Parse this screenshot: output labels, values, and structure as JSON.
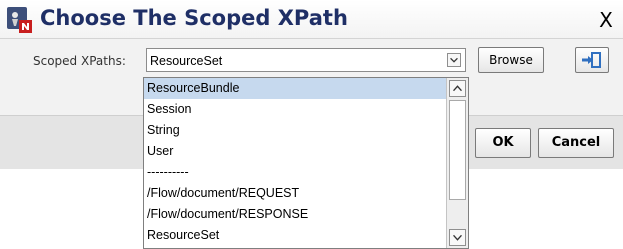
{
  "dialog": {
    "title": "Choose The Scoped XPath",
    "close_label": "X"
  },
  "form": {
    "scoped_xpaths_label": "Scoped XPaths:",
    "selected_value": "ResourceSet",
    "browse_label": "Browse",
    "import_icon": "import-arrow-icon"
  },
  "dropdown": {
    "items": [
      "ResourceBundle",
      "Session",
      "String",
      "User",
      "----------",
      "/Flow/document/REQUEST",
      "/Flow/document/RESPONSE",
      "ResourceSet"
    ],
    "highlighted": "ResourceBundle"
  },
  "footer": {
    "ok_label": "OK",
    "cancel_label": "Cancel"
  },
  "colors": {
    "title_text": "#1f2f66",
    "highlight": "#c6d9ee",
    "import_arrow": "#2f6fc0"
  }
}
